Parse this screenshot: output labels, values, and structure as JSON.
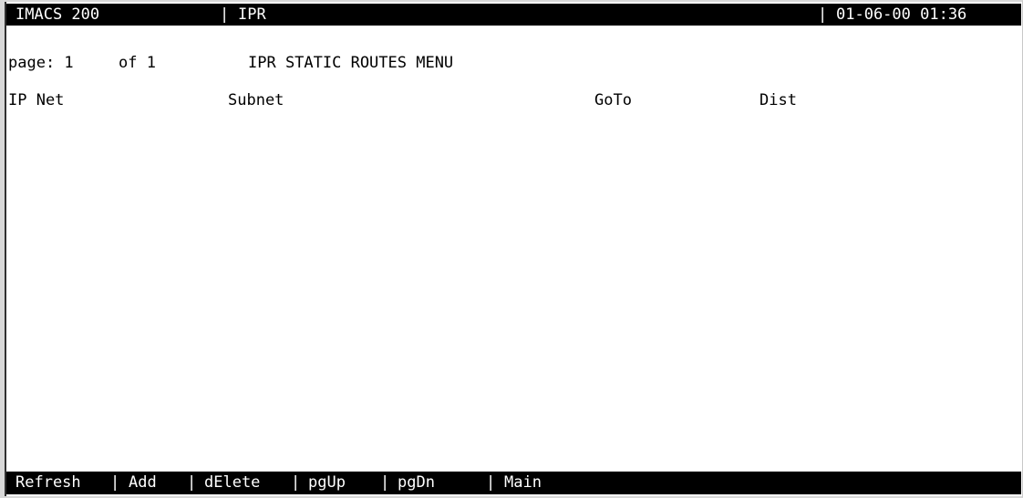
{
  "status_bar": {
    "system": "IMACS 200",
    "separator_1": "|",
    "module": "IPR",
    "separator_2": "|",
    "datetime": "01-06-00 01:36"
  },
  "page_info": {
    "page_label": "page: 1",
    "of_label": "of 1",
    "menu_title": "IPR STATIC ROUTES MENU"
  },
  "table": {
    "columns": [
      "IP Net",
      "Subnet",
      "GoTo",
      "Dist"
    ],
    "rows": []
  },
  "command_bar": {
    "refresh": "Refresh",
    "add": "Add",
    "delete": "dElete",
    "page_up": "pgUp",
    "page_down": "pgDn",
    "main": "Main",
    "separator": "|"
  },
  "colors": {
    "bar_background": "#000000",
    "bar_text": "#ffffff",
    "screen_background": "#ffffff",
    "screen_text": "#000000"
  }
}
